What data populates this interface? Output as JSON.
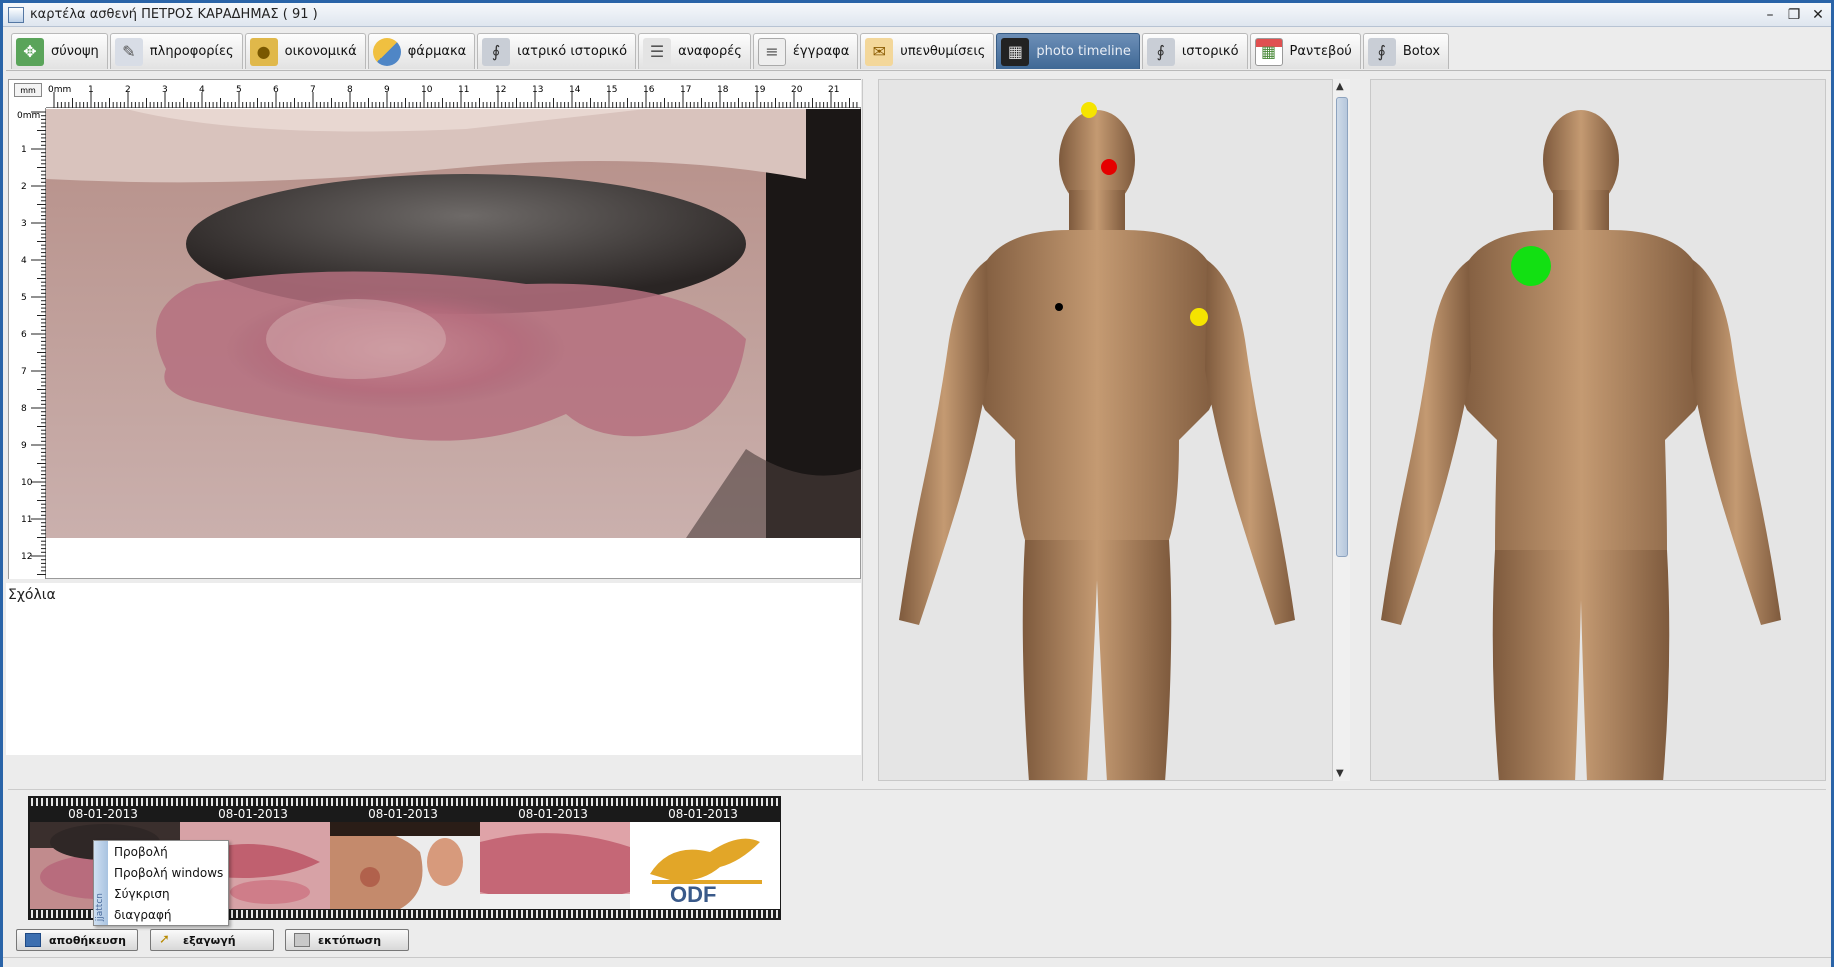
{
  "window": {
    "title": "καρτέλα ασθενή ΠΕΤΡΟΣ ΚΑΡΑΔΗΜΑΣ ( 91 )",
    "controls": {
      "minimize": "–",
      "restore": "❐",
      "close": "✕"
    }
  },
  "tabs": [
    {
      "label": "σύνοψη",
      "icon": "overview-icon",
      "active": false
    },
    {
      "label": "πληροφορίες",
      "icon": "info-icon",
      "active": false
    },
    {
      "label": "οικονομικά",
      "icon": "coins-icon",
      "active": false
    },
    {
      "label": "φάρμακα",
      "icon": "pill-icon",
      "active": false
    },
    {
      "label": "ιατρικό ιστορικό",
      "icon": "stethoscope-icon",
      "active": false
    },
    {
      "label": "αναφορές",
      "icon": "report-icon",
      "active": false
    },
    {
      "label": "έγγραφα",
      "icon": "document-icon",
      "active": false
    },
    {
      "label": "υπενθυμίσεις",
      "icon": "reminder-icon",
      "active": false
    },
    {
      "label": "photo timeline",
      "icon": "film-icon",
      "active": true
    },
    {
      "label": "ιστορικό",
      "icon": "stethoscope-icon",
      "active": false
    },
    {
      "label": "Ραντεβού",
      "icon": "calendar-icon",
      "active": false
    },
    {
      "label": "Botox",
      "icon": "stethoscope-icon",
      "active": false
    }
  ],
  "viewer": {
    "unit_button": "mm",
    "ruler_origin_top": "0mm",
    "ruler_origin_left": "0mm",
    "top_ticks": [
      "1",
      "2",
      "3",
      "4",
      "5",
      "6",
      "7",
      "8",
      "9",
      "10",
      "11",
      "12",
      "13",
      "14",
      "15",
      "16",
      "17",
      "18",
      "19",
      "20",
      "21",
      "2"
    ],
    "left_ticks": [
      "1",
      "2",
      "3",
      "4",
      "5",
      "6",
      "7",
      "8",
      "9",
      "10",
      "11",
      "12"
    ]
  },
  "comments": {
    "label": "Σχόλια"
  },
  "body_map": {
    "front_markers": [
      {
        "color": "#f5e400",
        "part": "head-top"
      },
      {
        "color": "#e50000",
        "part": "cheek"
      },
      {
        "color": "#000000",
        "part": "chest"
      },
      {
        "color": "#f5e400",
        "part": "upper-arm"
      }
    ],
    "back_markers": [
      {
        "color": "#12e012",
        "part": "shoulder"
      }
    ]
  },
  "filmstrip": {
    "frames": [
      {
        "date": "08-01-2013",
        "kind": "scalp-lesion"
      },
      {
        "date": "08-01-2013",
        "kind": "skin-rash"
      },
      {
        "date": "08-01-2013",
        "kind": "face-side"
      },
      {
        "date": "08-01-2013",
        "kind": "neck-rash"
      },
      {
        "date": "08-01-2013",
        "kind": "logo",
        "logo_text": "ODF"
      }
    ]
  },
  "context_menu": {
    "side_label": "jjattcn",
    "items": [
      "Προβολή",
      "Προβολή windows",
      "Σύγκριση",
      "διαγραφή"
    ]
  },
  "buttons": {
    "save": "αποθήκευση",
    "export": "εξαγωγή",
    "print": "εκτύπωση"
  }
}
